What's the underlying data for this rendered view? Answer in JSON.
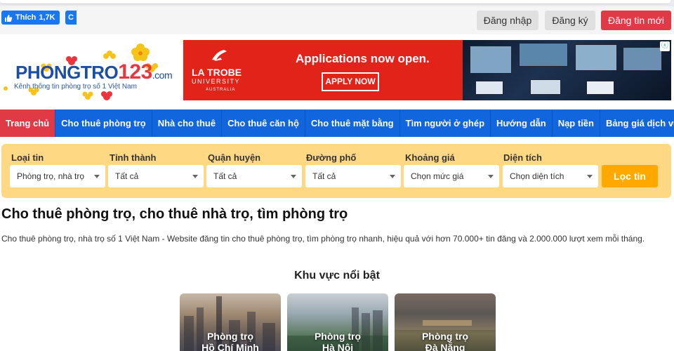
{
  "topbar": {
    "like_label": "Thích",
    "like_count": "1,7K",
    "share_label": "C",
    "login": "Đăng nhập",
    "register": "Đăng ký",
    "post": "Đăng tin mới"
  },
  "logo": {
    "brand_main": "PHONGTRO",
    "brand_num": "123",
    "brand_tld": ".com",
    "tagline": "Kênh thông tin phòng trọ số 1 Việt Nam"
  },
  "ad": {
    "brand_name": "LA TROBE",
    "brand_sub": "UNIVERSITY",
    "brand_country": "AUSTRALIA",
    "headline": "Applications now open.",
    "cta": "APPLY NOW",
    "close": "ⓧ"
  },
  "nav": {
    "items": [
      "Trang chủ",
      "Cho thuê phòng trọ",
      "Nhà cho thuê",
      "Cho thuê căn hộ",
      "Cho thuê mặt bằng",
      "Tìm người ở ghép",
      "Hướng dẫn",
      "Nạp tiền",
      "Bảng giá dịch vụ"
    ]
  },
  "filter": {
    "fields": [
      {
        "label": "Loại tin",
        "value": "Phòng trọ, nhà trọ"
      },
      {
        "label": "Tỉnh thành",
        "value": "Tất cả"
      },
      {
        "label": "Quận huyện",
        "value": "Tất cả"
      },
      {
        "label": "Đường phố",
        "value": "Tất cả"
      },
      {
        "label": "Khoảng giá",
        "value": "Chọn mức giá"
      },
      {
        "label": "Diện tích",
        "value": "Chọn diện tích"
      }
    ],
    "button": "Lọc tin"
  },
  "content": {
    "title": "Cho thuê phòng trọ, cho thuê nhà trọ, tìm phòng trọ",
    "description": "Cho thuê phòng trọ, nhà trọ số 1 Việt Nam - Website đăng tin cho thuê phòng trọ, tìm phòng trọ nhanh, hiệu quả với hơn 70.000+ tin đăng và 2.000.000 lượt xem mỗi tháng.",
    "section_title": "Khu vực nổi bật",
    "regions": [
      {
        "line1": "Phòng trọ",
        "line2": "Hồ Chí Minh"
      },
      {
        "line1": "Phòng trọ",
        "line2": "Hà Nội"
      },
      {
        "line1": "Phòng trọ",
        "line2": "Đà Nẵng"
      }
    ]
  },
  "colors": {
    "nav_bg": "#1266dd",
    "active": "#e13a47",
    "filter_bg": "#fed883",
    "filter_btn": "#ffa800",
    "ad_bg": "#e2231a"
  }
}
